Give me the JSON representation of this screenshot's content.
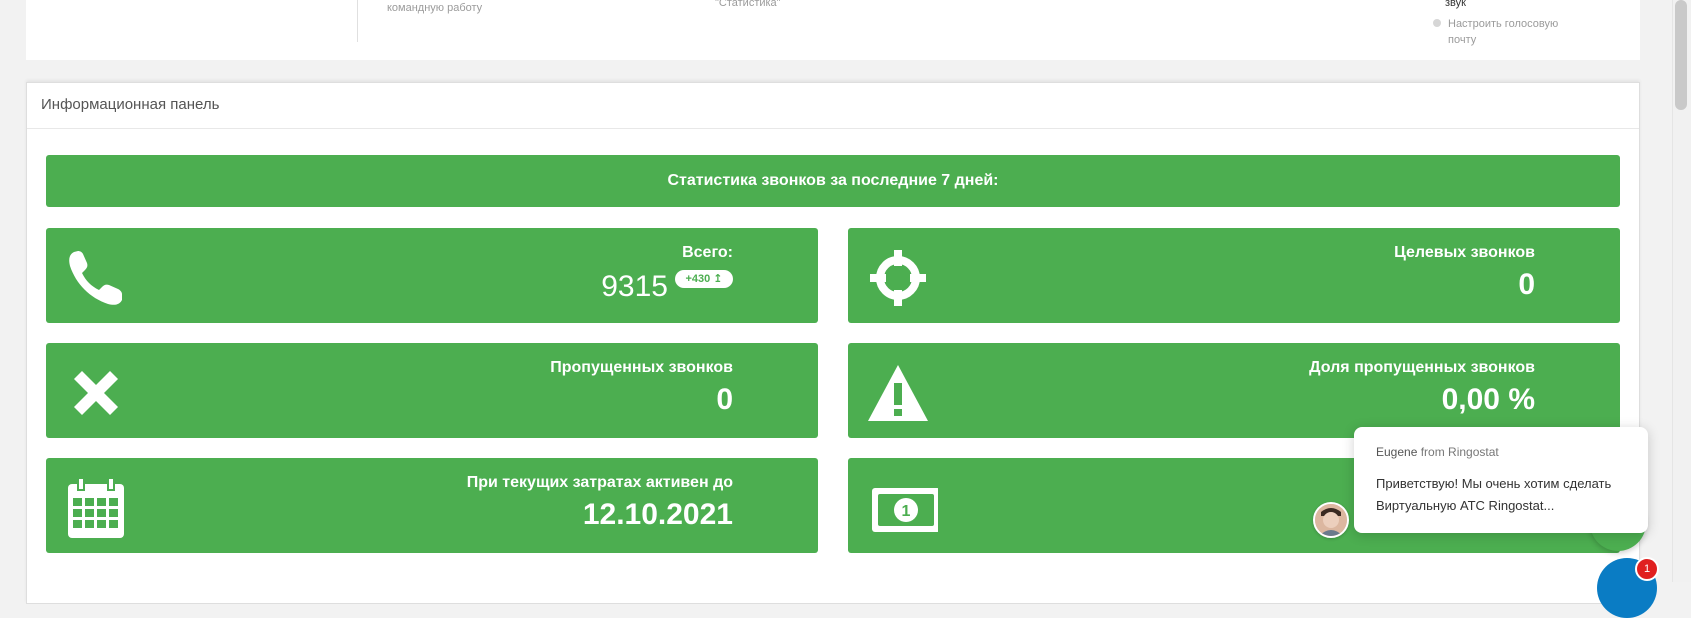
{
  "top_strip": {
    "text_team": "командную работу",
    "text_stats": "\"Статистика\"",
    "text_sound": "звук",
    "text_voicemail": "Настроить голосовую почту"
  },
  "panel": {
    "title": "Информационная панель",
    "banner": "Статистика звонков за последние 7 дней:"
  },
  "tiles": [
    {
      "label": "Всего:",
      "value": "9315",
      "badge": "+430 ↥",
      "icon": "phone-icon"
    },
    {
      "label": "Целевых звонков",
      "value": "0",
      "icon": "crosshair-icon"
    },
    {
      "label": "Пропущенных звонков",
      "value": "0",
      "icon": "close-icon"
    },
    {
      "label": "Доля пропущенных звонков",
      "value": "0,00 %",
      "icon": "warning-icon"
    },
    {
      "label": "При текущих затратах активен до",
      "value": "12.10.2021",
      "icon": "calendar-icon"
    },
    {
      "label": "",
      "value": "",
      "icon": "money-icon"
    }
  ],
  "chat": {
    "sender": "Eugene",
    "from_text": "from Ringostat",
    "message": "Приветствую! Мы очень хотим сделать Виртуальную АТС Ringostat..."
  },
  "notification_count": "1",
  "colors": {
    "accent": "#4cae50",
    "chat_button": "#0a7cc4",
    "badge": "#e02020"
  }
}
